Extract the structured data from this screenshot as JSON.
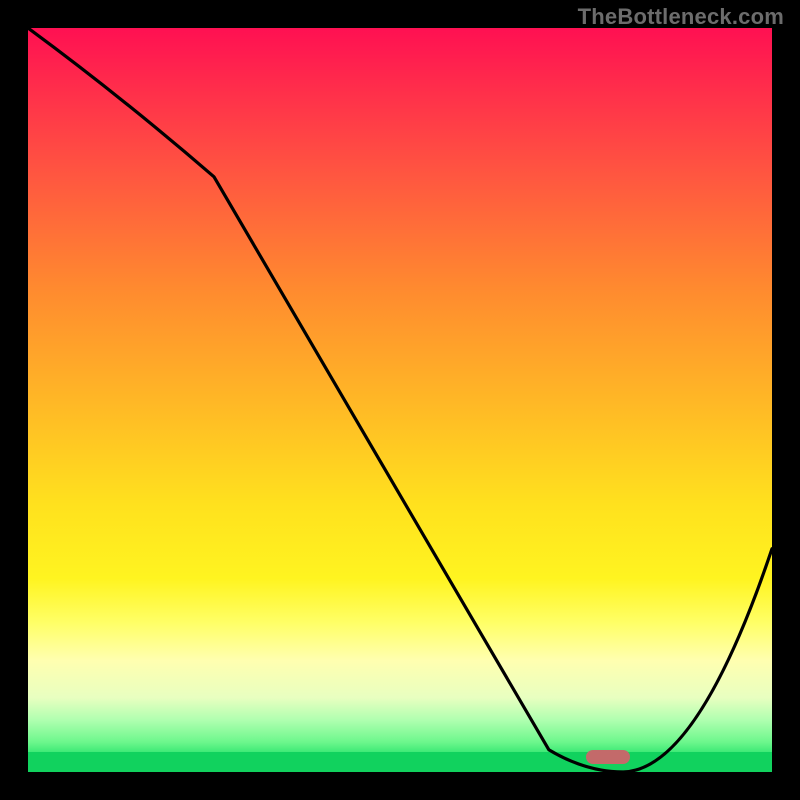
{
  "watermark": "TheBottleneck.com",
  "chart_data": {
    "type": "line",
    "title": "",
    "xlabel": "",
    "ylabel": "",
    "xlim": [
      0,
      100
    ],
    "ylim": [
      0,
      100
    ],
    "grid": false,
    "legend": false,
    "series": [
      {
        "name": "bottleneck-curve",
        "x": [
          0,
          25,
          70,
          80,
          100
        ],
        "values": [
          100,
          80,
          3,
          0,
          30
        ]
      }
    ],
    "marker": {
      "name": "optimal-region",
      "x": 78,
      "y": 2,
      "color": "#c36a6a"
    },
    "background_gradient_stops": [
      {
        "pos": 0,
        "color": "#ff1052"
      },
      {
        "pos": 50,
        "color": "#ffb726"
      },
      {
        "pos": 80,
        "color": "#ffff67"
      },
      {
        "pos": 100,
        "color": "#11d25e"
      }
    ]
  }
}
